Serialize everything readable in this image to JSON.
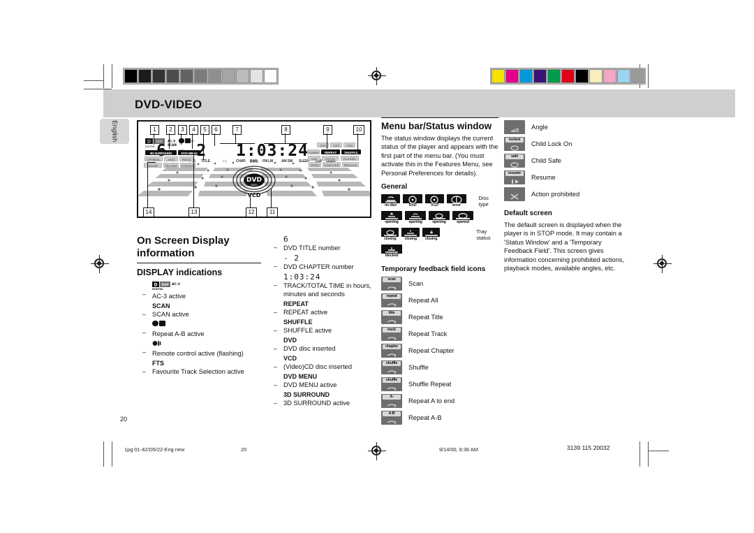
{
  "page": {
    "header_title": "DVD-VIDEO",
    "language_tab": "English",
    "page_number": "20"
  },
  "colorbars": {
    "grayscale_steps": [
      "#000000",
      "#1c1c1c",
      "#333333",
      "#4d4d4d",
      "#636363",
      "#7b7b7b",
      "#8f8f8f",
      "#a5a5a5",
      "#bcbcbc",
      "#e4e4e4",
      "#ffffff"
    ],
    "color_steps": [
      "#f5e400",
      "#e3008c",
      "#0099da",
      "#3b1478",
      "#009b4d",
      "#e2001a",
      "#000000",
      "#f7edbd",
      "#f4a7c3",
      "#9ed2f2",
      "#9a9a9a"
    ]
  },
  "display_figure": {
    "callouts": [
      "1",
      "2",
      "3",
      "4",
      "5",
      "6",
      "7",
      "8",
      "9",
      "10",
      "11",
      "12",
      "13",
      "14"
    ],
    "title_number": "6",
    "chapter_number": "- 2",
    "time_readout": "1:03:24",
    "labels": {
      "fts": "FTS",
      "title": "TITLE",
      "chapter": "CHAP.",
      "bar": "BAR",
      "fmlw": "FM LW",
      "amsw": "AM SW",
      "sleep": "SLEEP",
      "dim": "DIM",
      "timer": "TIMER",
      "ac3": "AC-3",
      "dsp": "DSP",
      "digital": "DIGITAL",
      "dvd_menu": "DVD MENU",
      "surround_3d": "3D SURROUND",
      "dvd": "DVD",
      "vcd": "VCD",
      "dbb": "DBB"
    },
    "eq_left": [
      "OPTIMAL",
      "JAZZ",
      "ROCK",
      "TECHNO",
      "MOVIE",
      "CONCERT"
    ],
    "eq_right_top": [
      "CD1",
      "CD2",
      "CD3"
    ],
    "eq_right": [
      "REPEAT",
      "SHUFFLE",
      "VOCAL",
      "CLASSIC",
      "KARAOKE",
      "REGGAE"
    ],
    "eq_right_left": [
      "TUNER",
      "AUX",
      "VIDEO"
    ]
  },
  "left_column": {
    "heading_line1": "On Screen Display",
    "heading_line2": "information",
    "subheading": "DISPLAY indications",
    "items": [
      {
        "glyph": "AC-3",
        "glyph_kind": "ac3",
        "desc": "AC-3 active"
      },
      {
        "glyph": "SCAN",
        "glyph_kind": "text",
        "desc": "SCAN active"
      },
      {
        "glyph": "A-B",
        "glyph_kind": "ab",
        "desc": "Repeat A-B active"
      },
      {
        "glyph": "remote",
        "glyph_kind": "remote",
        "desc": "Remote control active (flashing)"
      },
      {
        "glyph": "FTS",
        "glyph_kind": "text",
        "desc": "Favourite Track Selection active"
      }
    ]
  },
  "middle_column": {
    "items": [
      {
        "glyph": "6",
        "glyph_kind": "lcd",
        "desc": "DVD TITLE number"
      },
      {
        "glyph": "- 2",
        "glyph_kind": "lcd",
        "desc": "DVD CHAPTER number"
      },
      {
        "glyph": "1:03:24",
        "glyph_kind": "lcd",
        "desc": "TRACK/TOTAL TIME in hours, minutes and seconds"
      },
      {
        "glyph": "REPEAT",
        "glyph_kind": "text",
        "desc": "REPEAT active"
      },
      {
        "glyph": "SHUFFLE",
        "glyph_kind": "text",
        "desc": "SHUFFLE active"
      },
      {
        "glyph": "DVD",
        "glyph_kind": "text",
        "desc": "DVD disc inserted"
      },
      {
        "glyph": "VCD",
        "glyph_kind": "text",
        "desc": "(Video)CD disc inserted"
      },
      {
        "glyph": "DVD MENU",
        "glyph_kind": "text",
        "desc": "DVD MENU active"
      },
      {
        "glyph": "3D SURROUND",
        "glyph_kind": "text",
        "desc": "3D SURROUND active"
      }
    ]
  },
  "menubar_section": {
    "heading": "Menu bar/Status window",
    "body": "The status window displays the current status of the player and appears with the first part of the menu bar. (You must activate this in the Features Menu, see Personal Preferences for details).",
    "general_heading": "General",
    "general_rows": [
      {
        "icons": [
          {
            "label": "no disc",
            "sym": "disc-tray"
          },
          {
            "label": "DVD",
            "sym": "disc"
          },
          {
            "label": "VCD",
            "sym": "disc"
          },
          {
            "label": "error",
            "sym": "error"
          }
        ],
        "caption": "Disc type"
      },
      {
        "icons": [
          {
            "label": "opening",
            "sym": "tray-open-1"
          },
          {
            "label": "opening",
            "sym": "tray-open-2"
          },
          {
            "label": "opening",
            "sym": "tray-open-3"
          },
          {
            "label": "opened",
            "sym": "tray-opened"
          }
        ],
        "caption": ""
      },
      {
        "icons": [
          {
            "label": "closing",
            "sym": "tray-close-1"
          },
          {
            "label": "closing",
            "sym": "tray-close-2"
          },
          {
            "label": "closing",
            "sym": "tray-close-3"
          }
        ],
        "caption": "Tray status"
      },
      {
        "icons": [
          {
            "label": "blocked",
            "sym": "tray-blocked"
          }
        ],
        "caption": ""
      }
    ],
    "temp_heading": "Temporary feedback field icons",
    "temp_icons": [
      {
        "label": "scan",
        "caption": "Scan"
      },
      {
        "label": "repeat",
        "caption": "Repeat All"
      },
      {
        "label": "title",
        "caption": "Repeat Title"
      },
      {
        "label": "track",
        "caption": "Repeat Track"
      },
      {
        "label": "chapter",
        "caption": "Repeat Chapter"
      },
      {
        "label": "shuffle",
        "caption": "Shuffle"
      },
      {
        "label": "shuffle",
        "caption": "Shuffle Repeat"
      },
      {
        "label": "A-",
        "caption": "Repeat A to end"
      },
      {
        "label": "A-B",
        "caption": "Repeat A-B"
      }
    ]
  },
  "right_column": {
    "status_icons": [
      {
        "label": "",
        "caption": "Angle"
      },
      {
        "label": "locked",
        "caption": "Child Lock On"
      },
      {
        "label": "safe",
        "caption": "Child Safe"
      },
      {
        "label": "resume",
        "caption": "Resume"
      },
      {
        "label": "",
        "caption": "Action prohibited"
      }
    ],
    "default_heading": "Default screen",
    "default_body": "The default screen is displayed when the player is in STOP mode.  It may contain a 'Status Window' and a 'Temporary Feedback Field'.  This screen gives information concerning prohibited actions, playback modes, available angles, etc."
  },
  "footer": {
    "file_name": "1pg 01-42/D5/22-Eng new",
    "page": "20",
    "timestamp": "9/14/00, 8:36 AM",
    "doc_code": "3139 115 20032"
  }
}
